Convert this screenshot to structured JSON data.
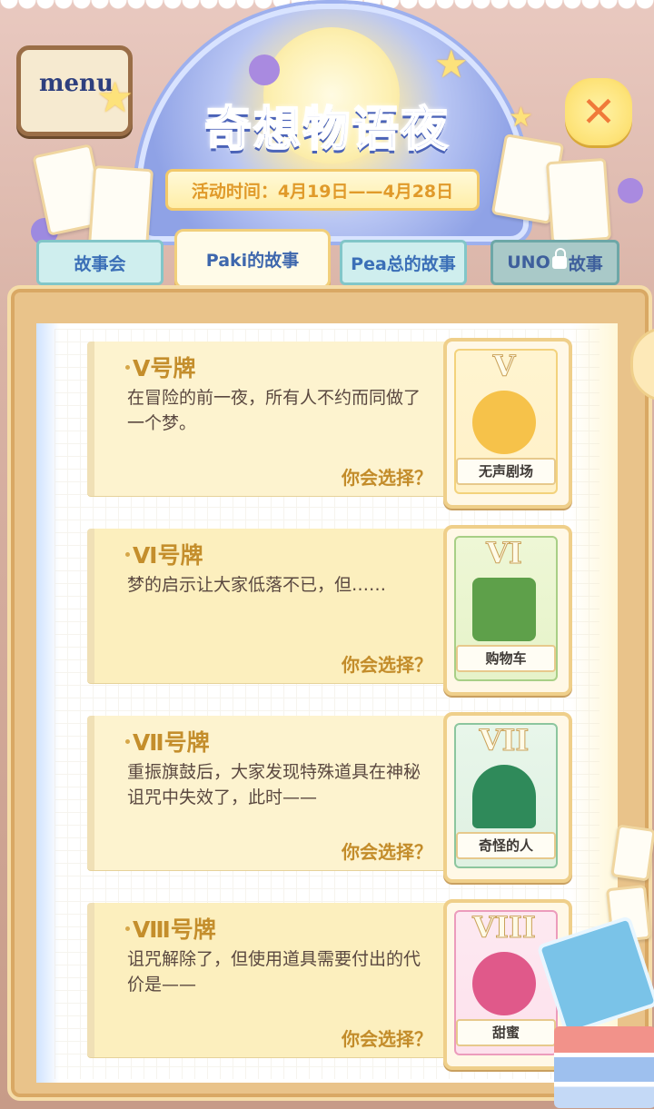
{
  "header": {
    "menu_sign": "menu",
    "title": "奇想物语夜",
    "event_date": "活动时间：4月19日——4月28日"
  },
  "tabs": [
    {
      "label": "故事会",
      "state": "normal"
    },
    {
      "label": "Paki的故事",
      "state": "active"
    },
    {
      "label": "Pea总的故事",
      "state": "normal"
    },
    {
      "label_left": "UNO",
      "label_right": "故事",
      "state": "locked"
    }
  ],
  "stories": [
    {
      "title": "Ⅴ号牌",
      "desc": "在冒险的前一夜，所有人不约而同做了一个梦。",
      "choose": "你会选择？",
      "card": {
        "numeral": "V",
        "name": "无声剧场",
        "color": "#f6c24a",
        "bg": "#fff1c8"
      }
    },
    {
      "title": "Ⅵ号牌",
      "desc": "梦的启示让大家低落不已，但……",
      "choose": "你会选择？",
      "card": {
        "numeral": "VI",
        "name": "购物车",
        "color": "#5ea04a",
        "bg": "#e6f3c9"
      }
    },
    {
      "title": "Ⅶ号牌",
      "desc": "重振旗鼓后，大家发现特殊道具在神秘诅咒中失效了，此时——",
      "choose": "你会选择？",
      "card": {
        "numeral": "VII",
        "name": "奇怪的人",
        "color": "#2f8a5a",
        "bg": "#dff1e2"
      }
    },
    {
      "title": "Ⅷ号牌",
      "desc": "诅咒解除了，但使用道具需要付出的代价是——",
      "choose": "你会选择？",
      "card": {
        "numeral": "VIII",
        "name": "甜蜜",
        "color": "#e0598a",
        "bg": "#fde1ec"
      }
    }
  ],
  "colors": {
    "accent": "#c48e2c",
    "tab_text": "#3e67ad",
    "close": "#f07a3a"
  }
}
